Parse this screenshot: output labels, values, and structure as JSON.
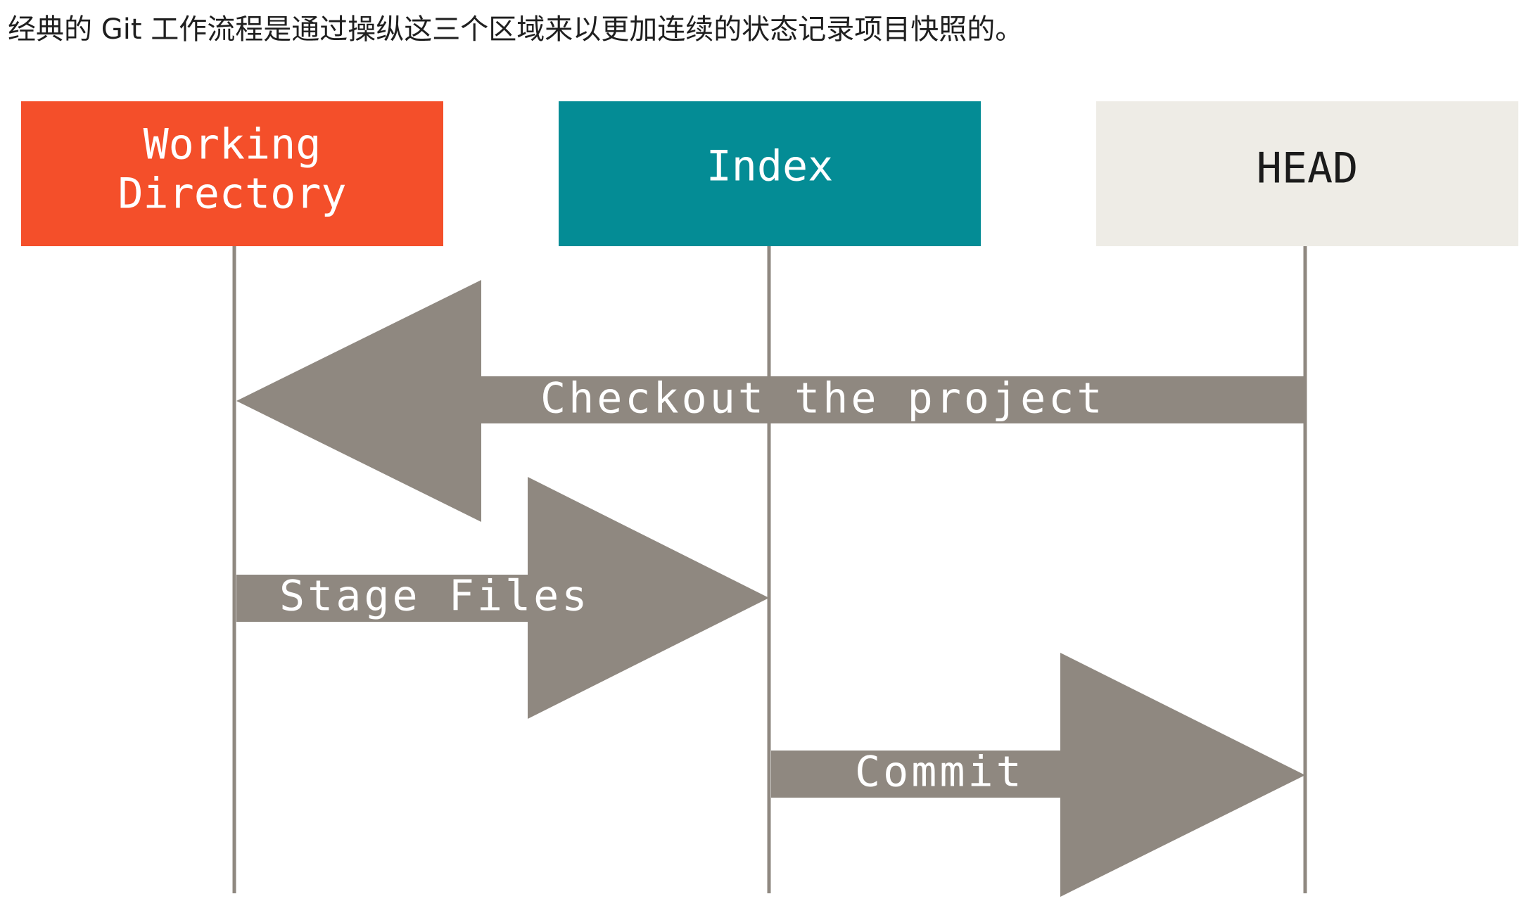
{
  "caption": "经典的 Git 工作流程是通过操纵这三个区域来以更加连续的状态记录项目快照的。",
  "colors": {
    "working_directory": "#f44f2a",
    "index": "#048c95",
    "head": "#eeece6",
    "arrow": "#8f8880",
    "lifeline": "#8f8880",
    "label_on_dark": "#ffffff",
    "label_on_light": "#1b1b1b"
  },
  "areas": {
    "working_directory": {
      "line1": "Working",
      "line2": "Directory"
    },
    "index": {
      "label": "Index"
    },
    "head": {
      "label": "HEAD"
    }
  },
  "arrows": {
    "checkout": {
      "label": "Checkout the project",
      "from": "HEAD",
      "to": "Working Directory"
    },
    "stage": {
      "label": "Stage Files",
      "from": "Working Directory",
      "to": "Index"
    },
    "commit": {
      "label": "Commit",
      "from": "Index",
      "to": "HEAD"
    }
  }
}
